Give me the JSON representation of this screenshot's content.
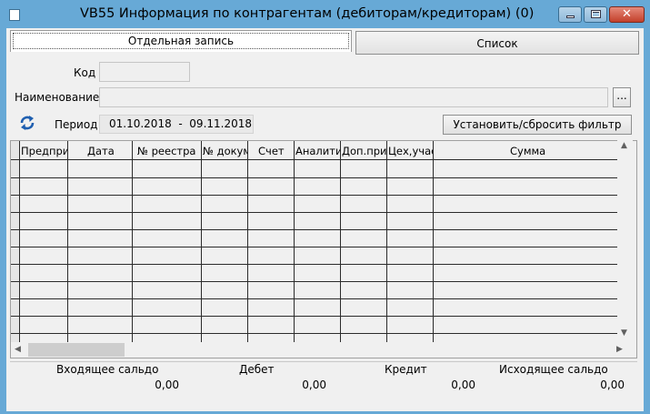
{
  "window": {
    "title": "VB55 Информация по контрагентам (дебиторам/кредиторам) (0)",
    "close_glyph": "✕"
  },
  "tabs": [
    {
      "label": "Отдельная запись",
      "active": true
    },
    {
      "label": "Список",
      "active": false
    }
  ],
  "form": {
    "code_label": "Код",
    "code_value": "",
    "name_label": "Наименование",
    "name_value": "",
    "browse_label": "...",
    "period_label": "Период",
    "period_value": "01.10.2018  -  09.11.2018",
    "filter_button": "Установить/сбросить фильтр"
  },
  "grid": {
    "columns": [
      "Предприя",
      "Дата",
      "№ реестра",
      "№ докуме",
      "Счет",
      "Аналитик",
      "Доп.приз",
      "Цех,участ",
      "Сумма"
    ],
    "rows": [
      [],
      [],
      [],
      [],
      [],
      [],
      [],
      [],
      [],
      [],
      []
    ]
  },
  "summary": {
    "labels": [
      "Входящее сальдо",
      "Дебет",
      "Кредит",
      "Исходящее сальдо"
    ],
    "values": [
      "0,00",
      "0,00",
      "0,00",
      "0,00"
    ]
  },
  "icons": {
    "refresh": "refresh-arrows-icon"
  }
}
